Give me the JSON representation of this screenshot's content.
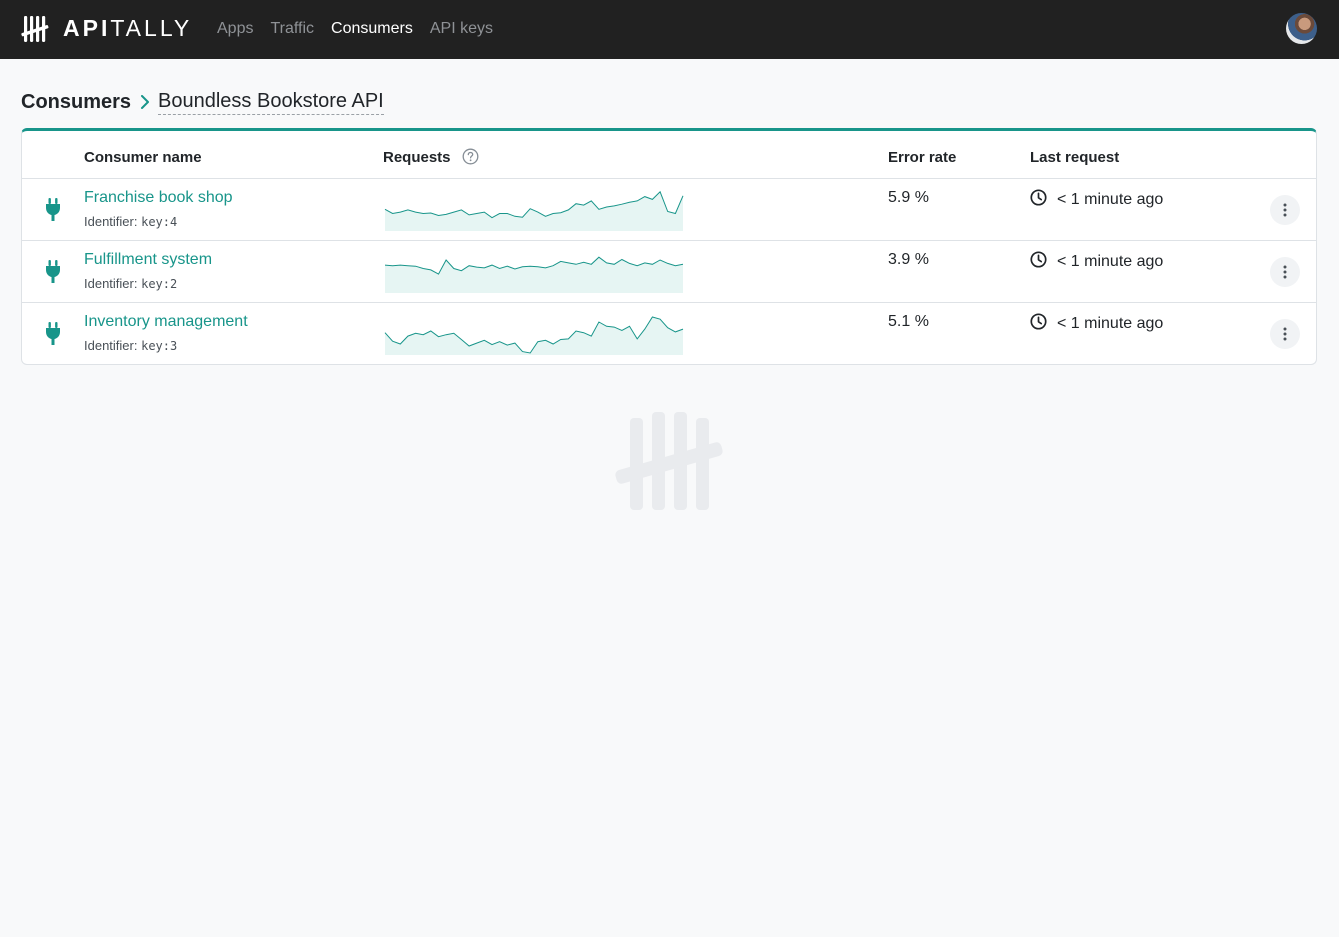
{
  "header": {
    "logo_bold": "API",
    "logo_light": "TALLY",
    "nav": [
      {
        "label": "Apps",
        "active": false
      },
      {
        "label": "Traffic",
        "active": false
      },
      {
        "label": "Consumers",
        "active": true
      },
      {
        "label": "API keys",
        "active": false
      }
    ]
  },
  "breadcrumb": {
    "root": "Consumers",
    "current": "Boundless Bookstore API"
  },
  "table": {
    "columns": {
      "name": "Consumer name",
      "requests": "Requests",
      "error_rate": "Error rate",
      "last_request": "Last request"
    },
    "identifier_label": "Identifier:",
    "rows": [
      {
        "name": "Franchise book shop",
        "identifier": "key:4",
        "error_rate": "5.9 %",
        "last_request": "< 1 minute ago",
        "requests_series": [
          0.7,
          0.55,
          0.6,
          0.68,
          0.6,
          0.55,
          0.57,
          0.48,
          0.52,
          0.6,
          0.68,
          0.5,
          0.55,
          0.6,
          0.4,
          0.55,
          0.55,
          0.45,
          0.42,
          0.72,
          0.6,
          0.45,
          0.55,
          0.58,
          0.68,
          0.9,
          0.85,
          1.0,
          0.7,
          0.78,
          0.82,
          0.88,
          0.95,
          1.0,
          1.15,
          1.05,
          1.32,
          0.62,
          0.55,
          1.18
        ]
      },
      {
        "name": "Fulfillment system",
        "identifier": "key:2",
        "error_rate": "3.9 %",
        "last_request": "< 1 minute ago",
        "requests_series": [
          0.92,
          0.9,
          0.92,
          0.9,
          0.88,
          0.8,
          0.75,
          0.6,
          1.1,
          0.8,
          0.72,
          0.9,
          0.85,
          0.82,
          0.92,
          0.8,
          0.88,
          0.78,
          0.86,
          0.88,
          0.86,
          0.82,
          0.9,
          1.05,
          1.0,
          0.95,
          1.02,
          0.95,
          1.2,
          1.0,
          0.95,
          1.12,
          0.98,
          0.9,
          1.0,
          0.95,
          1.1,
          0.98,
          0.9,
          0.95
        ]
      },
      {
        "name": "Inventory management",
        "identifier": "key:3",
        "error_rate": "5.1 %",
        "last_request": "< 1 minute ago",
        "requests_series": [
          0.72,
          0.42,
          0.32,
          0.6,
          0.7,
          0.65,
          0.78,
          0.58,
          0.65,
          0.7,
          0.48,
          0.25,
          0.35,
          0.45,
          0.3,
          0.4,
          0.28,
          0.35,
          0.05,
          0.0,
          0.4,
          0.45,
          0.32,
          0.48,
          0.5,
          0.78,
          0.72,
          0.6,
          1.1,
          0.95,
          0.92,
          0.8,
          0.95,
          0.5,
          0.85,
          1.28,
          1.2,
          0.9,
          0.75,
          0.85
        ]
      }
    ]
  },
  "colors": {
    "accent": "#18958a",
    "header_bg": "#212121",
    "spark_fill": "#e6f5f3"
  }
}
